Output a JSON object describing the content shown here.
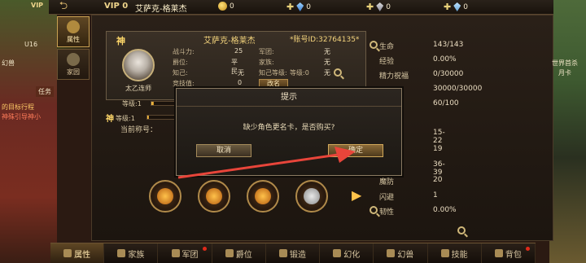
{
  "topbar": {
    "vip": "VIP 0",
    "player_name": "艾萨克-格莱杰",
    "gold": "0",
    "gem": "0",
    "bound_gem": "0",
    "silver": "0",
    "corner_vip": "VIP"
  },
  "left_overlay": {
    "level_text": "U16",
    "channel": "任务",
    "quest_title": "的目标行程",
    "quest_desc": "神殊引导神小",
    "extra_label": "幻兽"
  },
  "side_tabs": [
    {
      "label": "属性"
    },
    {
      "label": "家园"
    }
  ],
  "char_card": {
    "god_mark": "神",
    "name": "艾萨克-格莱杰",
    "id_label": "*账号ID:32764135*",
    "avatar_name": "太乙连师",
    "stats": [
      {
        "label": "战斗力:",
        "value": "25"
      },
      {
        "label": "军团:",
        "value": "无"
      },
      {
        "label": "爵位:",
        "value": "平民"
      },
      {
        "label": "家族:",
        "value": "无"
      },
      {
        "label": "知己:",
        "value": "无"
      },
      {
        "label": "知己等级:",
        "value": "无"
      },
      {
        "label": "竞技值:",
        "value": "0"
      },
      {
        "label": "等级:0",
        "value": ""
      }
    ],
    "rename_button": "改名",
    "level_label": "等级:1",
    "god_level_label": "等级:1",
    "current_title_label": "当前称号：",
    "level_progress": 0.12,
    "god_progress": 0.05
  },
  "right_stats": [
    {
      "label": "生命",
      "value": "143/143"
    },
    {
      "label": "经验",
      "value": "0.00%"
    },
    {
      "label": "精力祝福",
      "value": "0/30000"
    },
    {
      "label": "",
      "value": "30000/30000"
    },
    {
      "label": "",
      "value": "60/100"
    },
    {
      "label": "",
      "value": "15-22"
    },
    {
      "label": "",
      "value": "19"
    },
    {
      "label": "",
      "value": "36-39"
    },
    {
      "label": "魔防",
      "value": "20"
    },
    {
      "label": "闪避",
      "value": "1"
    },
    {
      "label": "韧性",
      "value": "0.00%"
    }
  ],
  "dialog": {
    "title": "提示",
    "message": "缺少角色更名卡，是否购买?",
    "cancel": "取消",
    "confirm": "确定"
  },
  "bottom_tabs": [
    {
      "label": "属性",
      "icon": "attr-icon",
      "dot": false
    },
    {
      "label": "家族",
      "icon": "family-icon",
      "dot": false
    },
    {
      "label": "军团",
      "icon": "legion-icon",
      "dot": true
    },
    {
      "label": "爵位",
      "icon": "rank-icon",
      "dot": false
    },
    {
      "label": "锻造",
      "icon": "forge-icon",
      "dot": false
    },
    {
      "label": "幻化",
      "icon": "transform-icon",
      "dot": false
    },
    {
      "label": "幻兽",
      "icon": "beast-icon",
      "dot": false
    },
    {
      "label": "技能",
      "icon": "skill-icon",
      "dot": false
    },
    {
      "label": "背包",
      "icon": "bag-icon",
      "dot": true
    }
  ],
  "right_overlay": {
    "line1": "世界首杀",
    "line2": "月卡"
  },
  "colors": {
    "accent": "#f3d37c",
    "alert_arrow": "#e8453a",
    "dot": "#e02a1a"
  }
}
